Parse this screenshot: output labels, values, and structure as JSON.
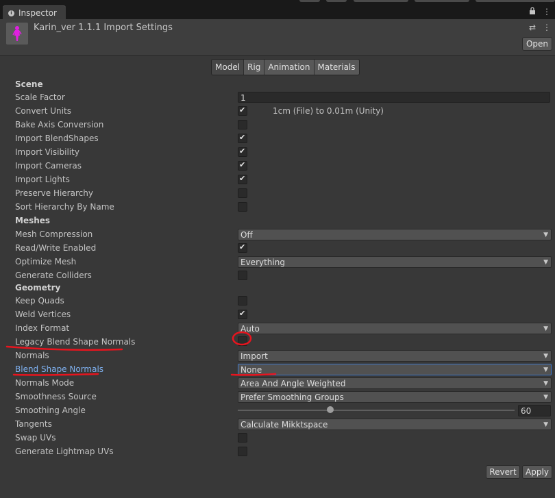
{
  "window": {
    "tab_label": "Inspector",
    "tab_icon": "info-icon",
    "top_icons": [
      "lock-icon",
      "more-vert-icon"
    ]
  },
  "header": {
    "title": "Karin_ver 1.1.1 Import Settings",
    "asset_icon": "model-asset-icon",
    "header_icons": [
      "preset-icon",
      "more-vert-icon"
    ],
    "open_label": "Open"
  },
  "tabs": [
    {
      "label": "Model",
      "selected": true
    },
    {
      "label": "Rig",
      "selected": false
    },
    {
      "label": "Animation",
      "selected": false
    },
    {
      "label": "Materials",
      "selected": false
    }
  ],
  "scene": {
    "heading": "Scene",
    "scale_factor_label": "Scale Factor",
    "scale_factor_value": "1",
    "convert_units_label": "Convert Units",
    "convert_units_note": "1cm (File) to 0.01m (Unity)",
    "bake_axis_label": "Bake Axis Conversion",
    "import_blendshapes_label": "Import BlendShapes",
    "import_visibility_label": "Import Visibility",
    "import_cameras_label": "Import Cameras",
    "import_lights_label": "Import Lights",
    "preserve_hierarchy_label": "Preserve Hierarchy",
    "sort_hierarchy_label": "Sort Hierarchy By Name"
  },
  "meshes": {
    "heading": "Meshes",
    "mesh_compression_label": "Mesh Compression",
    "mesh_compression_value": "Off",
    "read_write_label": "Read/Write Enabled",
    "optimize_mesh_label": "Optimize Mesh",
    "optimize_mesh_value": "Everything",
    "generate_colliders_label": "Generate Colliders"
  },
  "geometry": {
    "heading": "Geometry",
    "keep_quads_label": "Keep Quads",
    "weld_vertices_label": "Weld Vertices",
    "index_format_label": "Index Format",
    "index_format_value": "Auto",
    "legacy_blend_label": "Legacy Blend Shape Normals",
    "normals_label": "Normals",
    "normals_value": "Import",
    "blend_shape_normals_label": "Blend Shape Normals",
    "blend_shape_normals_value": "None",
    "normals_mode_label": "Normals Mode",
    "normals_mode_value": "Area And Angle Weighted",
    "smoothness_source_label": "Smoothness Source",
    "smoothness_source_value": "Prefer Smoothing Groups",
    "smoothing_angle_label": "Smoothing Angle",
    "smoothing_angle_value": "60",
    "smoothing_angle_max": 180,
    "tangents_label": "Tangents",
    "tangents_value": "Calculate Mikktspace",
    "swap_uvs_label": "Swap UVs",
    "lightmap_uvs_label": "Generate Lightmap UVs"
  },
  "checkboxes": {
    "convert_units": true,
    "bake_axis": false,
    "import_blendshapes": true,
    "import_visibility": true,
    "import_cameras": true,
    "import_lights": true,
    "preserve_hierarchy": false,
    "sort_hierarchy": false,
    "read_write": true,
    "generate_colliders": false,
    "keep_quads": false,
    "weld_vertices": true,
    "legacy_blend": false,
    "swap_uvs": false,
    "lightmap_uvs": false
  },
  "footer": {
    "revert_label": "Revert",
    "apply_label": "Apply"
  },
  "colors": {
    "annotation": "#e8141e",
    "highlight_label": "#7fb1f0",
    "selection_border": "#3e77c9"
  }
}
